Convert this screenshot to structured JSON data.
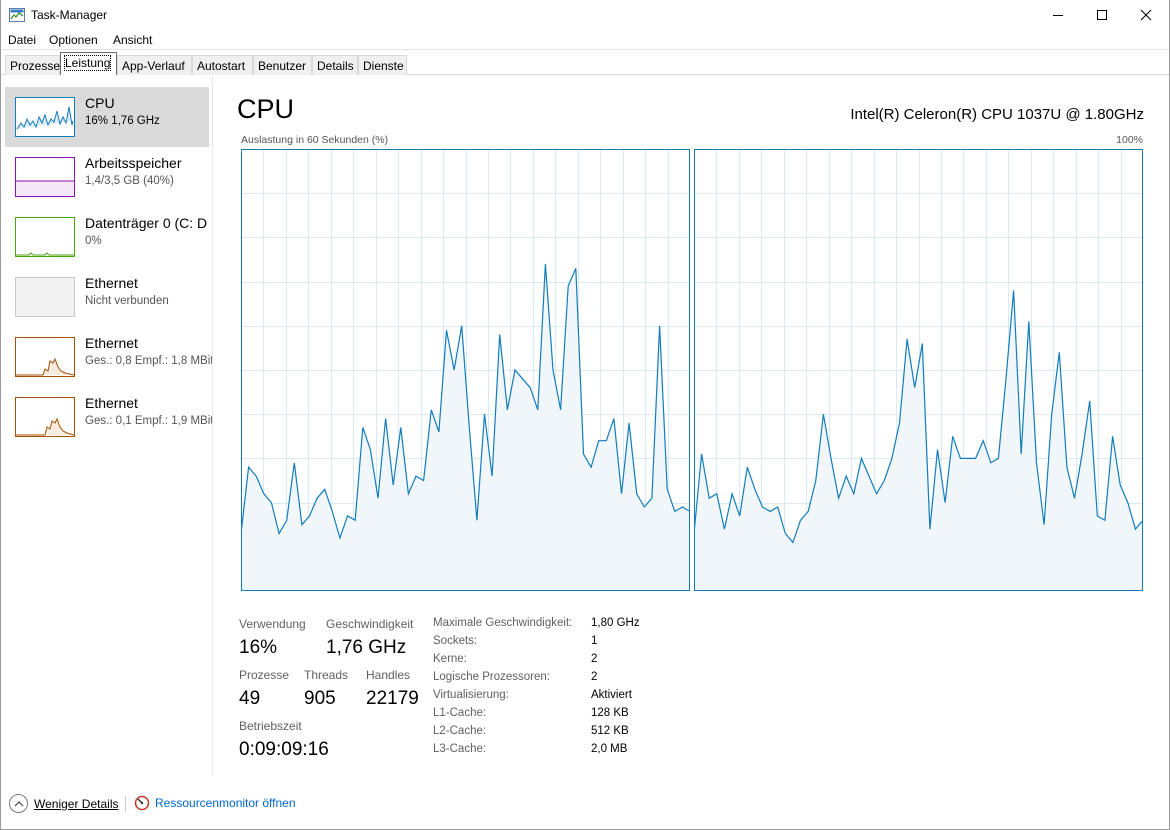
{
  "window": {
    "title": "Task-Manager"
  },
  "menu": [
    "Datei",
    "Optionen",
    "Ansicht"
  ],
  "tabs": [
    "Prozesse",
    "Leistung",
    "App-Verlauf",
    "Autostart",
    "Benutzer",
    "Details",
    "Dienste"
  ],
  "active_tab": "Leistung",
  "sidebar": [
    {
      "name": "CPU",
      "sub": "16% 1,76 GHz",
      "color": "#117dbb",
      "selected": true
    },
    {
      "name": "Arbeitsspeicher",
      "sub": "1,4/3,5 GB (40%)",
      "color": "#8b12ae"
    },
    {
      "name": "Datenträger 0 (C: D",
      "sub": "0%",
      "color": "#4da60c"
    },
    {
      "name": "Ethernet",
      "sub": "Nicht verbunden",
      "color": "#c8c8c8"
    },
    {
      "name": "Ethernet",
      "sub": "Ges.: 0,8  Empf.: 1,8 MBit",
      "color": "#a74f01"
    },
    {
      "name": "Ethernet",
      "sub": "Ges.: 0,1  Empf.: 1,9 MBit",
      "color": "#a74f01"
    }
  ],
  "main": {
    "title": "CPU",
    "model": "Intel(R) Celeron(R) CPU 1037U @ 1.80GHz",
    "graph_label": "Auslastung in 60 Sekunden (%)",
    "graph_max": "100%"
  },
  "stats": {
    "usage_label": "Verwendung",
    "usage": "16%",
    "speed_label": "Geschwindigkeit",
    "speed": "1,76 GHz",
    "processes_label": "Prozesse",
    "processes": "49",
    "threads_label": "Threads",
    "threads": "905",
    "handles_label": "Handles",
    "handles": "22179",
    "uptime_label": "Betriebszeit",
    "uptime": "0:09:09:16"
  },
  "details": [
    {
      "k": "Maximale Geschwindigkeit:",
      "v": "1,80 GHz"
    },
    {
      "k": "Sockets:",
      "v": "1"
    },
    {
      "k": "Kerne:",
      "v": "2"
    },
    {
      "k": "Logische Prozessoren:",
      "v": "2"
    },
    {
      "k": "Virtualisierung:",
      "v": "Aktiviert"
    },
    {
      "k": "L1-Cache:",
      "v": "128 KB"
    },
    {
      "k": "L2-Cache:",
      "v": "512 KB"
    },
    {
      "k": "L3-Cache:",
      "v": "2,0 MB"
    }
  ],
  "footer": {
    "fewer": "Weniger Details",
    "resmon": "Ressourcenmonitor öffnen"
  },
  "chart_data": [
    {
      "type": "area",
      "ylim": [
        0,
        100
      ],
      "series": [
        {
          "values": [
            13,
            28,
            26,
            22,
            20,
            13,
            16,
            29,
            15,
            17,
            21,
            23,
            18,
            12,
            17,
            16,
            37,
            32,
            21,
            39,
            24,
            37,
            22,
            26,
            25,
            41,
            36,
            59,
            50,
            60,
            37,
            16,
            40,
            26,
            58,
            41,
            50,
            48,
            46,
            41,
            74,
            50,
            41,
            69,
            73,
            31,
            28,
            34,
            34,
            39,
            22,
            38,
            22,
            19,
            21,
            60,
            23,
            18,
            19,
            18
          ]
        }
      ]
    },
    {
      "type": "area",
      "ylim": [
        0,
        100
      ],
      "series": [
        {
          "values": [
            13,
            31,
            21,
            22,
            14,
            22,
            17,
            28,
            23,
            19,
            18,
            19,
            13,
            11,
            16,
            18,
            25,
            40,
            30,
            21,
            26,
            22,
            30,
            26,
            22,
            25,
            30,
            38,
            57,
            46,
            56,
            14,
            32,
            20,
            35,
            30,
            30,
            30,
            34,
            29,
            30,
            48,
            68,
            31,
            61,
            29,
            15,
            40,
            54,
            28,
            21,
            31,
            43,
            17,
            16,
            35,
            24,
            20,
            14,
            16
          ]
        }
      ]
    }
  ]
}
